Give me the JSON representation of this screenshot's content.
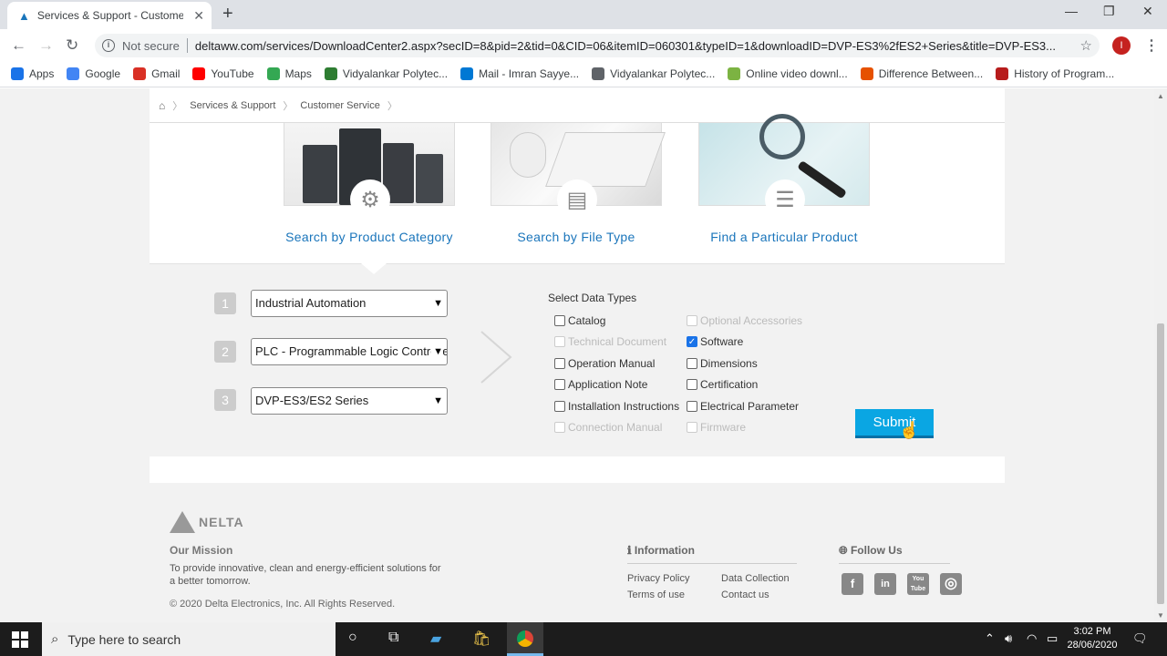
{
  "browser": {
    "tab_title": "Services & Support - Customer S",
    "security_label": "Not secure",
    "url": "deltaww.com/services/DownloadCenter2.aspx?secID=8&pid=2&tid=0&CID=06&itemID=060301&typeID=1&downloadID=DVP-ES3%2fES2+Series&title=DVP-ES3...",
    "profile_initial": "I",
    "bookmarks": [
      {
        "label": "Apps",
        "icon": "apps-grid-icon",
        "color": "#1a73e8"
      },
      {
        "label": "Google",
        "icon": "google-icon",
        "color": "#4285f4"
      },
      {
        "label": "Gmail",
        "icon": "gmail-icon",
        "color": "#d93025"
      },
      {
        "label": "YouTube",
        "icon": "youtube-icon",
        "color": "#ff0000"
      },
      {
        "label": "Maps",
        "icon": "maps-icon",
        "color": "#34a853"
      },
      {
        "label": "Vidyalankar Polytec...",
        "icon": "vp-icon",
        "color": "#2e7d32"
      },
      {
        "label": "Mail - Imran Sayye...",
        "icon": "outlook-icon",
        "color": "#0078d4"
      },
      {
        "label": "Vidyalankar Polytec...",
        "icon": "link-icon",
        "color": "#5f6368"
      },
      {
        "label": "Online video downl...",
        "icon": "download-icon",
        "color": "#7cb342"
      },
      {
        "label": "Difference Between...",
        "icon": "puzzle-icon",
        "color": "#e65100"
      },
      {
        "label": "History of Program...",
        "icon": "book-icon",
        "color": "#b71c1c"
      }
    ]
  },
  "breadcrumb": [
    "Services & Support",
    "Customer Service"
  ],
  "search_cards": [
    {
      "label": "Search by Product Category",
      "icon": "gear-icon"
    },
    {
      "label": "Search by File Type",
      "icon": "document-icon"
    },
    {
      "label": "Find a Particular Product",
      "icon": "list-icon"
    }
  ],
  "form": {
    "steps": [
      {
        "number": "1",
        "value": "Industrial Automation"
      },
      {
        "number": "2",
        "value": "PLC - Programmable Logic Controller"
      },
      {
        "number": "3",
        "value": "DVP-ES3/ES2 Series"
      }
    ],
    "data_types_title": "Select Data Types",
    "checkboxes_left": [
      {
        "label": "Catalog",
        "checked": false,
        "disabled": false
      },
      {
        "label": "Technical Document",
        "checked": false,
        "disabled": true
      },
      {
        "label": "Operation Manual",
        "checked": false,
        "disabled": false
      },
      {
        "label": "Application Note",
        "checked": false,
        "disabled": false
      },
      {
        "label": "Installation Instructions",
        "checked": false,
        "disabled": false
      },
      {
        "label": "Connection Manual",
        "checked": false,
        "disabled": true
      }
    ],
    "checkboxes_right": [
      {
        "label": "Optional Accessories",
        "checked": false,
        "disabled": true
      },
      {
        "label": "Software",
        "checked": true,
        "disabled": false
      },
      {
        "label": "Dimensions",
        "checked": false,
        "disabled": false
      },
      {
        "label": "Certification",
        "checked": false,
        "disabled": false
      },
      {
        "label": "Electrical Parameter",
        "checked": false,
        "disabled": false
      },
      {
        "label": "Firmware",
        "checked": false,
        "disabled": true
      }
    ],
    "submit_label": "Submit"
  },
  "footer": {
    "logo_text": "NELTA",
    "mission_title": "Our Mission",
    "mission_text": "To provide innovative, clean and energy-efficient solutions for a better tomorrow.",
    "copyright": "© 2020 Delta Electronics, Inc. All Rights Reserved.",
    "info_title": "Information",
    "links": [
      "Privacy Policy",
      "Data Collection",
      "Terms of use",
      "Contact us"
    ],
    "follow_title": "Follow Us",
    "social": [
      {
        "label": "f",
        "icon": "facebook-icon"
      },
      {
        "label": "in",
        "icon": "linkedin-icon"
      },
      {
        "label": "You Tube",
        "icon": "youtube-social-icon"
      },
      {
        "label": "◎",
        "icon": "instagram-icon"
      }
    ]
  },
  "taskbar": {
    "search_placeholder": "Type here to search",
    "time": "3:02 PM",
    "date": "28/06/2020"
  }
}
